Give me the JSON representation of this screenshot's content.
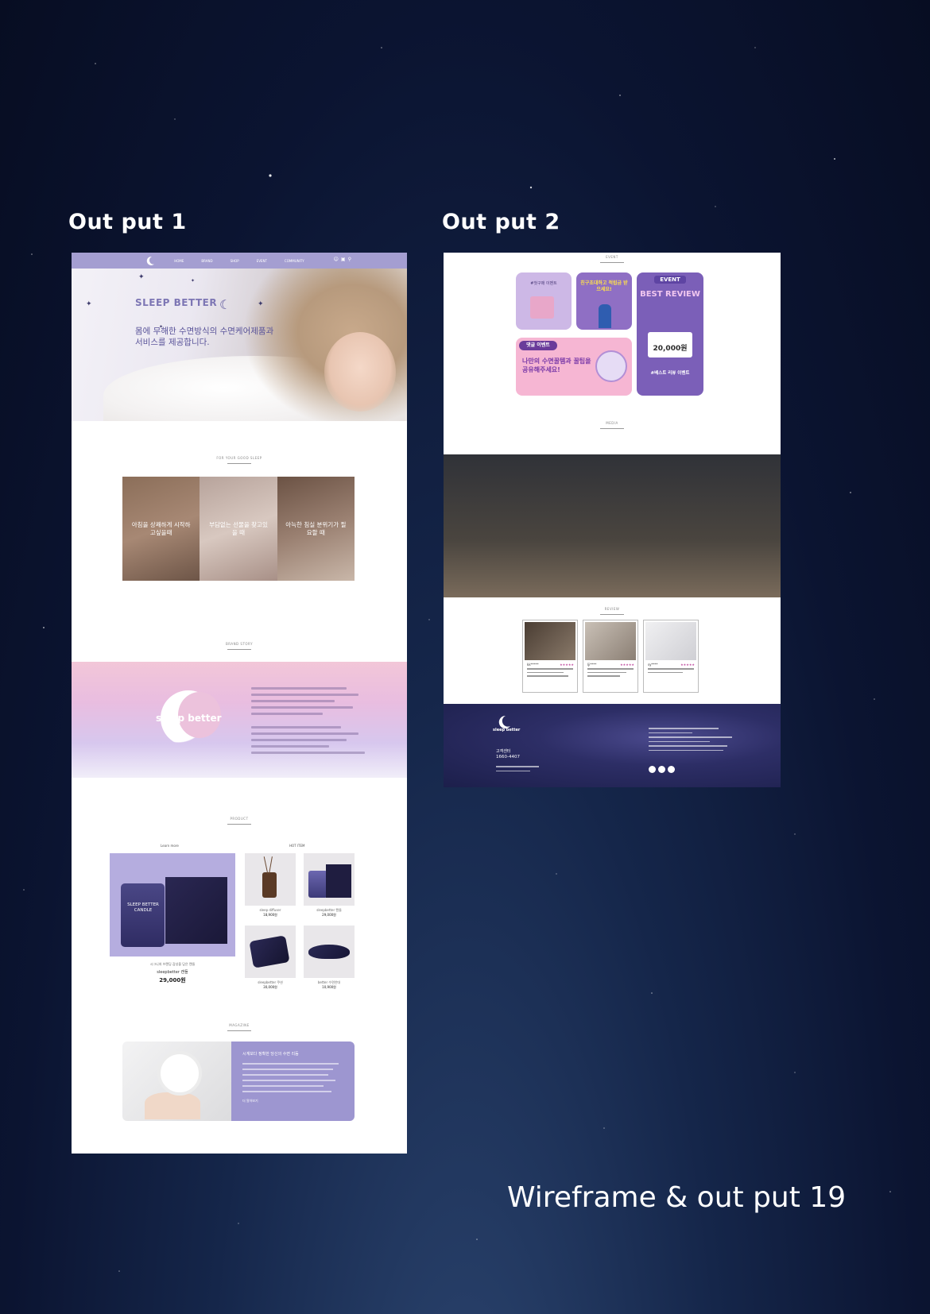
{
  "labels": {
    "output1": "Out put 1",
    "output2": "Out put 2",
    "page_footer": "Wireframe & out put 19"
  },
  "output1": {
    "nav_items": [
      "HOME",
      "BRAND",
      "SHOP",
      "EVENT",
      "COMMUNITY"
    ],
    "hero": {
      "brand": "SLEEP BETTER",
      "copy": "몸에 무해한 수면방식의 수면케어제품과 서비스를 제공합니다."
    },
    "for_good_sleep": {
      "section_title": "FOR YOUR GOOD SLEEP",
      "items": [
        "아침을 상쾌하게 시작하고싶을때",
        "부담없는 선물을 찾고있을 때",
        "아늑한 침실 분위기가 필요할 때"
      ]
    },
    "brand_story": {
      "section_title": "BRAND STORY",
      "logo_text": "sleep better"
    },
    "product": {
      "section_title": "PRODUCT",
      "learn_more": "Learn more",
      "hot_item": "HOT ITEM",
      "featured": {
        "jar_label": "SLEEP BETTER CANDLE",
        "caption": "시그니처 브랜딩 감성을 담은 캔들",
        "name": "sleepbetter 캔들",
        "price": "29,000원"
      },
      "items": [
        {
          "name": "sleep diffuser",
          "price": "18,900원"
        },
        {
          "name": "sleepbetter 캔들",
          "price": "29,000원"
        },
        {
          "name": "sleepbetter 쿠션",
          "price": "30,000원"
        },
        {
          "name": "better 수면안대",
          "price": "10,900원"
        }
      ]
    },
    "magazine": {
      "section_title": "MAGAZINE",
      "headline": "시계보다 정확한 당신의 수면 리듬",
      "more": "더 알아보기"
    }
  },
  "output2": {
    "event": {
      "section_title": "EVENT",
      "card1": "#첫구매 이벤트",
      "card2": "친구초대하고 적립금 받으세요!",
      "card3_tag": "EVENT",
      "card3_title": "BEST REVIEW",
      "card3_amount": "20,000원",
      "card3_caption": "#베스트 리뷰 이벤트",
      "card4_tag": "댓글 이벤트",
      "card4_title": "나만의 수면꿀템과 꿀팁을 공유해주세요!"
    },
    "media": {
      "section_title": "MEDIA"
    },
    "review": {
      "section_title": "REVIEW",
      "cards": [
        {
          "user": "kk*****",
          "rating": "★★★★★"
        },
        {
          "user": "lji****",
          "rating": "★★★★★"
        },
        {
          "user": "sy****",
          "rating": "★★★★★"
        }
      ]
    },
    "footer": {
      "logo_text": "sleep better",
      "cs_label": "고객센터",
      "phone": "1660-4407"
    }
  },
  "colors": {
    "lavender": "#a49ed1",
    "deep_purple": "#7b5fb8",
    "pink": "#f3a9c9",
    "night_bg": "#0b1431"
  }
}
